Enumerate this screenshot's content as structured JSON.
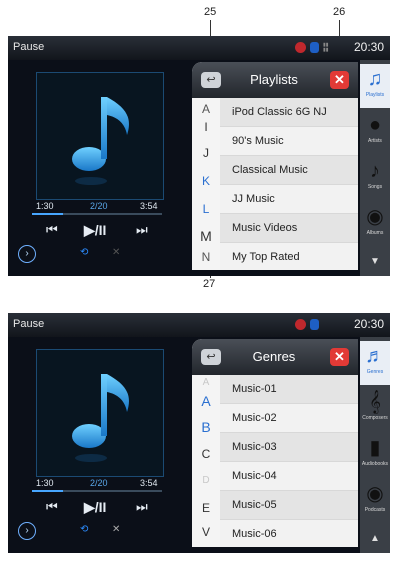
{
  "callouts": [
    "25",
    "26",
    "27"
  ],
  "screen1": {
    "status": "Pause",
    "clock": "20:30",
    "track_position": "1:30",
    "track_index": "2/20",
    "track_length": "3:54",
    "progress_fraction": 0.24,
    "panel_title": "Playlists",
    "letters": [
      "A",
      "I",
      "J",
      "K",
      "L",
      "M",
      "N"
    ],
    "items": [
      "iPod Classic 6G NJ",
      "90's Music",
      "Classical Music",
      "JJ Music",
      "Music Videos",
      "My Top Rated"
    ],
    "side": [
      {
        "label": "Playlists",
        "icon": "playlist-icon",
        "active": true
      },
      {
        "label": "Artists",
        "icon": "artist-icon",
        "active": false
      },
      {
        "label": "Songs",
        "icon": "song-icon",
        "active": false
      },
      {
        "label": "Albums",
        "icon": "album-icon",
        "active": false
      }
    ]
  },
  "screen2": {
    "status": "Pause",
    "clock": "20:30",
    "track_position": "1:30",
    "track_index": "2/20",
    "track_length": "3:54",
    "progress_fraction": 0.24,
    "panel_title": "Genres",
    "letters": [
      "A",
      "A",
      "B",
      "C",
      "D",
      "E",
      "V"
    ],
    "items": [
      "Music-01",
      "Music-02",
      "Music-03",
      "Music-04",
      "Music-05",
      "Music-06"
    ],
    "side": [
      {
        "label": "Genres",
        "icon": "genre-icon",
        "active": true
      },
      {
        "label": "Composers",
        "icon": "composer-icon",
        "active": false
      },
      {
        "label": "Audiobooks",
        "icon": "audiobook-icon",
        "active": false
      },
      {
        "label": "Podcasts",
        "icon": "podcast-icon",
        "active": false
      }
    ]
  },
  "colors": {
    "accent": "#47a6ff",
    "close": "#e23a36",
    "panel": "#f2f2f2"
  }
}
